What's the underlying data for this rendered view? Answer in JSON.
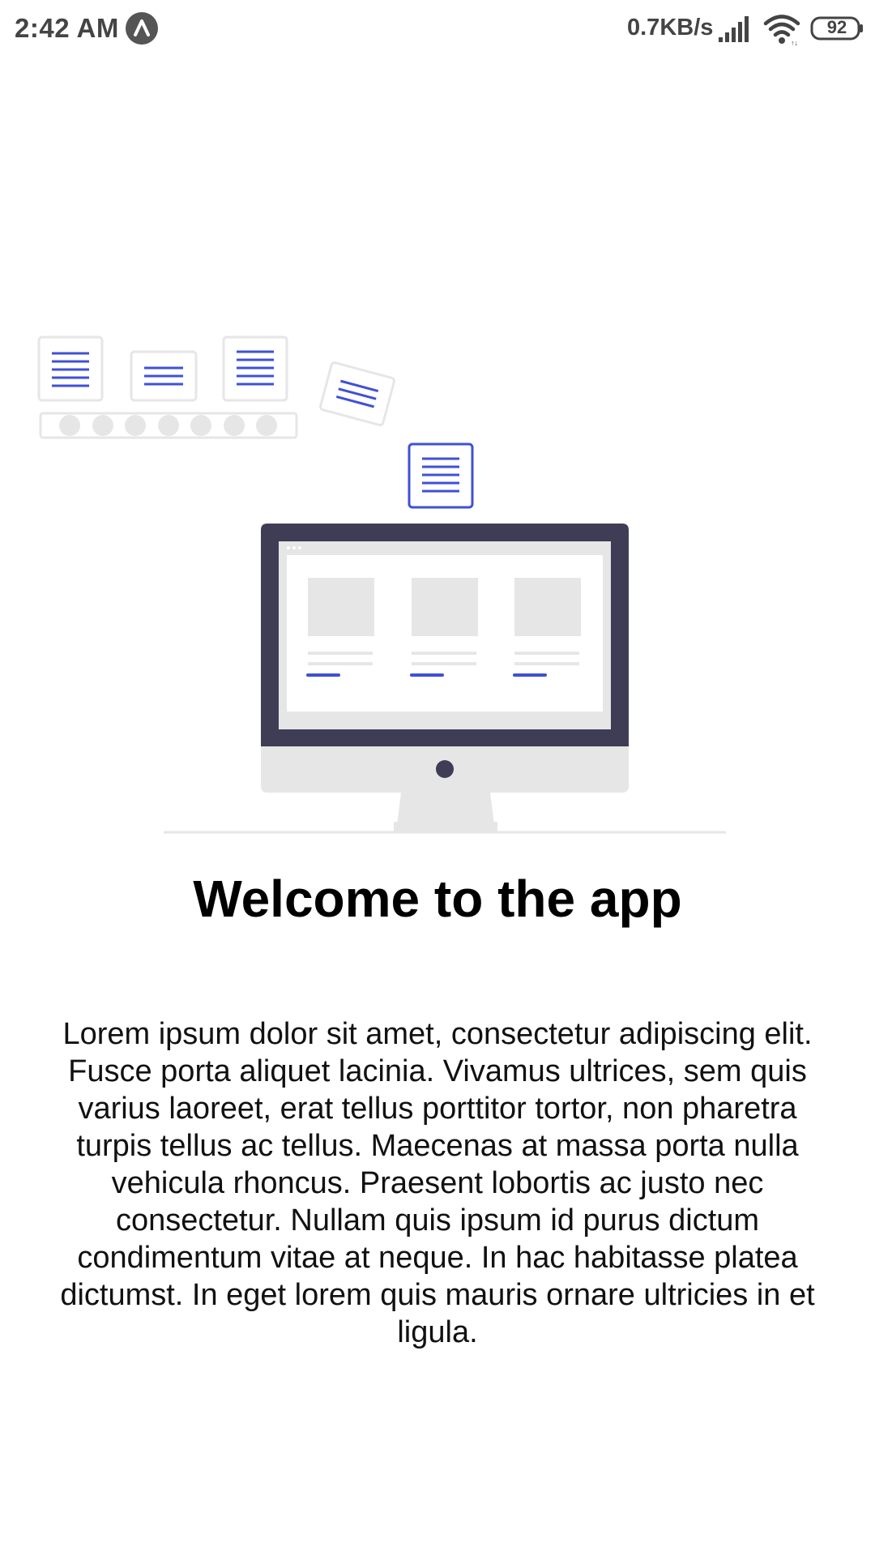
{
  "status_bar": {
    "time": "2:42 AM",
    "network_speed": "0.7KB/s",
    "battery_level": "92",
    "icons": [
      "app-notification-icon",
      "signal-icon",
      "wifi-icon",
      "battery-icon"
    ]
  },
  "main": {
    "title": "Welcome to the app",
    "body": "Lorem ipsum dolor sit amet, consectetur adipiscing elit. Fusce porta aliquet lacinia. Vivamus ultrices, sem quis varius laoreet, erat tellus porttitor tortor, non pharetra turpis tellus ac tellus. Maecenas at massa porta nulla vehicula rhoncus. Praesent lobortis ac justo nec consectetur. Nullam quis ipsum id purus dictum condimentum vitae at neque. In hac habitasse platea dictumst. In eget lorem quis mauris ornare ultricies in et ligula."
  },
  "colors": {
    "accent": "#3f51d6",
    "monitor_frame": "#3f3d56",
    "light_gray": "#e6e6e6",
    "status_text": "#444444"
  },
  "illustration": {
    "name": "computer-with-documents-illustration"
  }
}
